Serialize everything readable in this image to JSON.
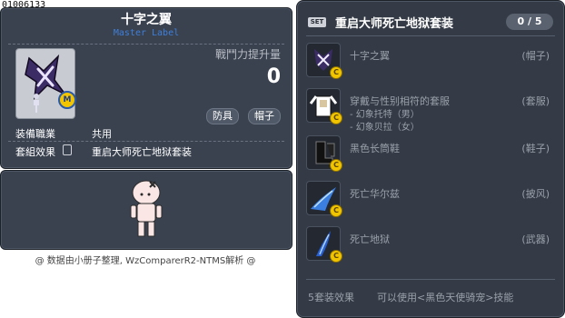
{
  "item_id": "01006133",
  "item": {
    "name": "十字之翼",
    "label": "Master Label",
    "stat_label": "戰鬥力提升量",
    "stat_value": "0",
    "tags": [
      "防具",
      "帽子"
    ],
    "job_label": "装備職業",
    "job_value": "共用",
    "set_label": "套組效果",
    "set_value": "重启大师死亡地狱套装"
  },
  "footer_note": "@ 数据由小册子整理, WzComparerR2-NTMS解析 @",
  "set": {
    "badge": "SET",
    "name": "重启大师死亡地狱套装",
    "count": "0 / 5",
    "items": [
      {
        "name": "十字之翼",
        "category": "(帽子)",
        "sub": [],
        "icon": "cross-wing-hat-icon"
      },
      {
        "name": "穿戴与性别相符的套服",
        "category": "(套服)",
        "sub": [
          "- 幻象托特（男）",
          "- 幻象贝拉（女）"
        ],
        "icon": "suit-overall-icon"
      },
      {
        "name": "黑色长筒鞋",
        "category": "(鞋子)",
        "sub": [],
        "icon": "black-boots-icon"
      },
      {
        "name": "死亡华尔兹",
        "category": "(披风)",
        "sub": [],
        "icon": "death-waltz-cape-icon"
      },
      {
        "name": "死亡地狱",
        "category": "(武器)",
        "sub": [],
        "icon": "death-hell-weapon-icon"
      }
    ],
    "effect_label": "5套装效果",
    "effect_text": "可以使用<黑色天使骑宠>技能"
  },
  "colors": {
    "panel": "#3a4250",
    "set_panel": "#343b46",
    "label_blue": "#3f7fd8",
    "coin": "#f0c400"
  }
}
